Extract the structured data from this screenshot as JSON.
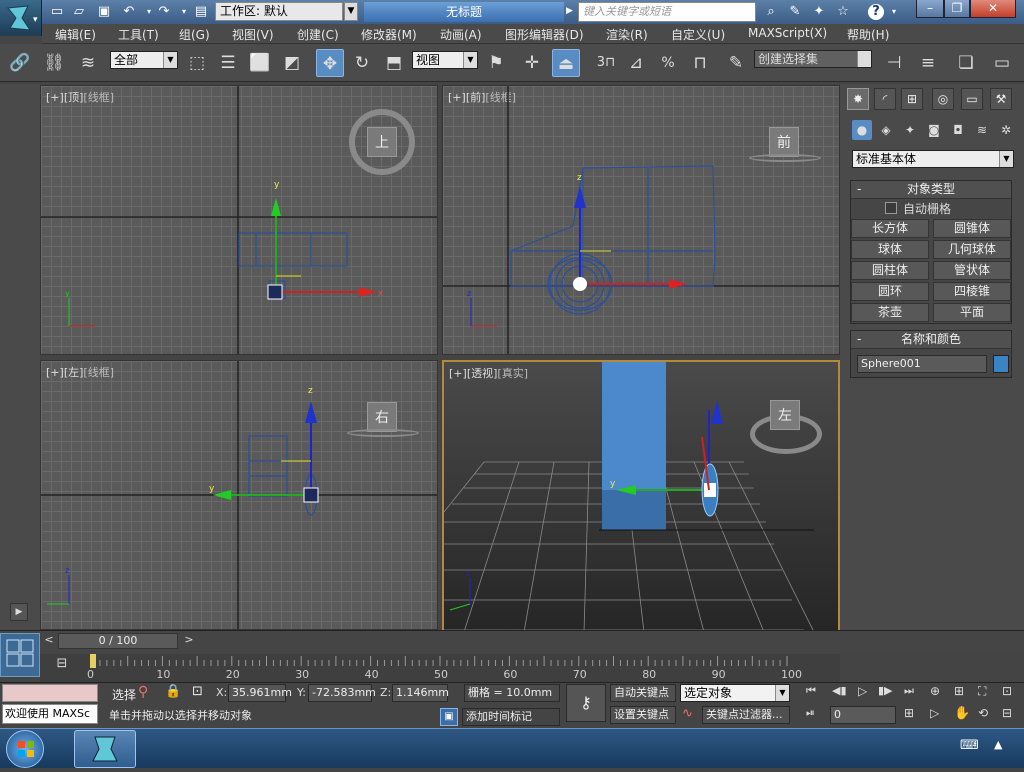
{
  "titlebar": {
    "workspace_label": "工作区: 默认",
    "doc_title": "无标题",
    "search_placeholder": "键入关键字或短语"
  },
  "menu": [
    "编辑(E)",
    "工具(T)",
    "组(G)",
    "视图(V)",
    "创建(C)",
    "修改器(M)",
    "动画(A)",
    "图形编辑器(D)",
    "渲染(R)",
    "自定义(U)",
    "MAXScript(X)",
    "帮助(H)"
  ],
  "toolbar": {
    "filter": "全部",
    "ref_coord": "视图",
    "selection_set": "创建选择集",
    "snap_3": "3",
    "snap_angle": "△",
    "snap_pct": "%"
  },
  "viewports": [
    {
      "plus": "[+]",
      "name": "[顶]",
      "mode": "[线框]",
      "cube": "上"
    },
    {
      "plus": "[+]",
      "name": "[前]",
      "mode": "[线框]",
      "cube": "前"
    },
    {
      "plus": "[+]",
      "name": "[左]",
      "mode": "[线框]",
      "cube": "右"
    },
    {
      "plus": "[+]",
      "name": "[透视]",
      "mode": "[真实]",
      "cube": "左"
    }
  ],
  "command_panel": {
    "dropdown": "标准基本体",
    "object_type_title": "对象类型",
    "autogrid": "自动栅格",
    "buttons": [
      "长方体",
      "圆锥体",
      "球体",
      "几何球体",
      "圆柱体",
      "管状体",
      "圆环",
      "四棱锥",
      "茶壶",
      "平面"
    ],
    "name_color_title": "名称和颜色",
    "object_name": "Sphere001",
    "object_color": "#3b83c4"
  },
  "timeline": {
    "frame": "0 / 100",
    "ticks": [
      "0",
      "10",
      "20",
      "30",
      "40",
      "50",
      "60",
      "70",
      "80",
      "90",
      "100"
    ]
  },
  "status": {
    "welcome": "欢迎使用 MAXSc",
    "select_label": "选择",
    "x_label": "X:",
    "x_value": "35.961mm",
    "y_label": "Y:",
    "y_value": "-72.583mm",
    "z_label": "Z:",
    "z_value": "1.146mm",
    "grid": "栅格 = 10.0mm",
    "auto_key": "自动关键点",
    "set_key": "设置关键点",
    "selected_object": "选定对象",
    "key_filters": "关键点过滤器...",
    "prompt": "单击并拖动以选择并移动对象",
    "add_time_tag": "添加时间标记",
    "frame_value": "0"
  }
}
